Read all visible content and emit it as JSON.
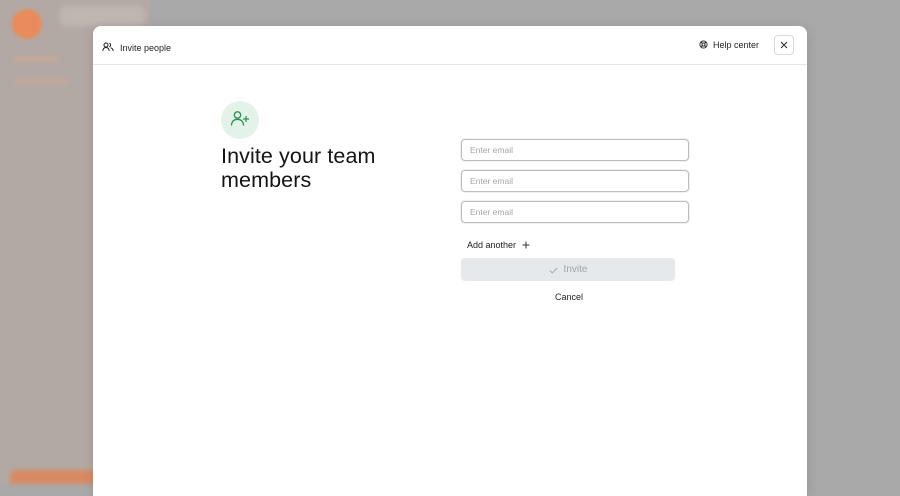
{
  "header": {
    "title": "Invite people",
    "title_icon": "users-icon",
    "help_label": "Help center",
    "help_icon": "lifebuoy-icon",
    "close_icon": "close-icon"
  },
  "main": {
    "icon": "user-plus-icon",
    "heading": "Invite your team members"
  },
  "form": {
    "emails": [
      {
        "placeholder": "Enter email",
        "value": ""
      },
      {
        "placeholder": "Enter email",
        "value": ""
      },
      {
        "placeholder": "Enter email",
        "value": ""
      }
    ],
    "add_another_label": "Add another",
    "add_icon": "plus-icon",
    "invite_label": "Invite",
    "invite_icon": "check-icon",
    "cancel_label": "Cancel"
  },
  "colors": {
    "backdrop": "#a9a9a9",
    "icon_circle_bg": "#e3f3e8",
    "icon_green": "#2f8f55",
    "invite_disabled_bg": "#e6e9ec",
    "invite_disabled_text": "#9ea3a8"
  }
}
